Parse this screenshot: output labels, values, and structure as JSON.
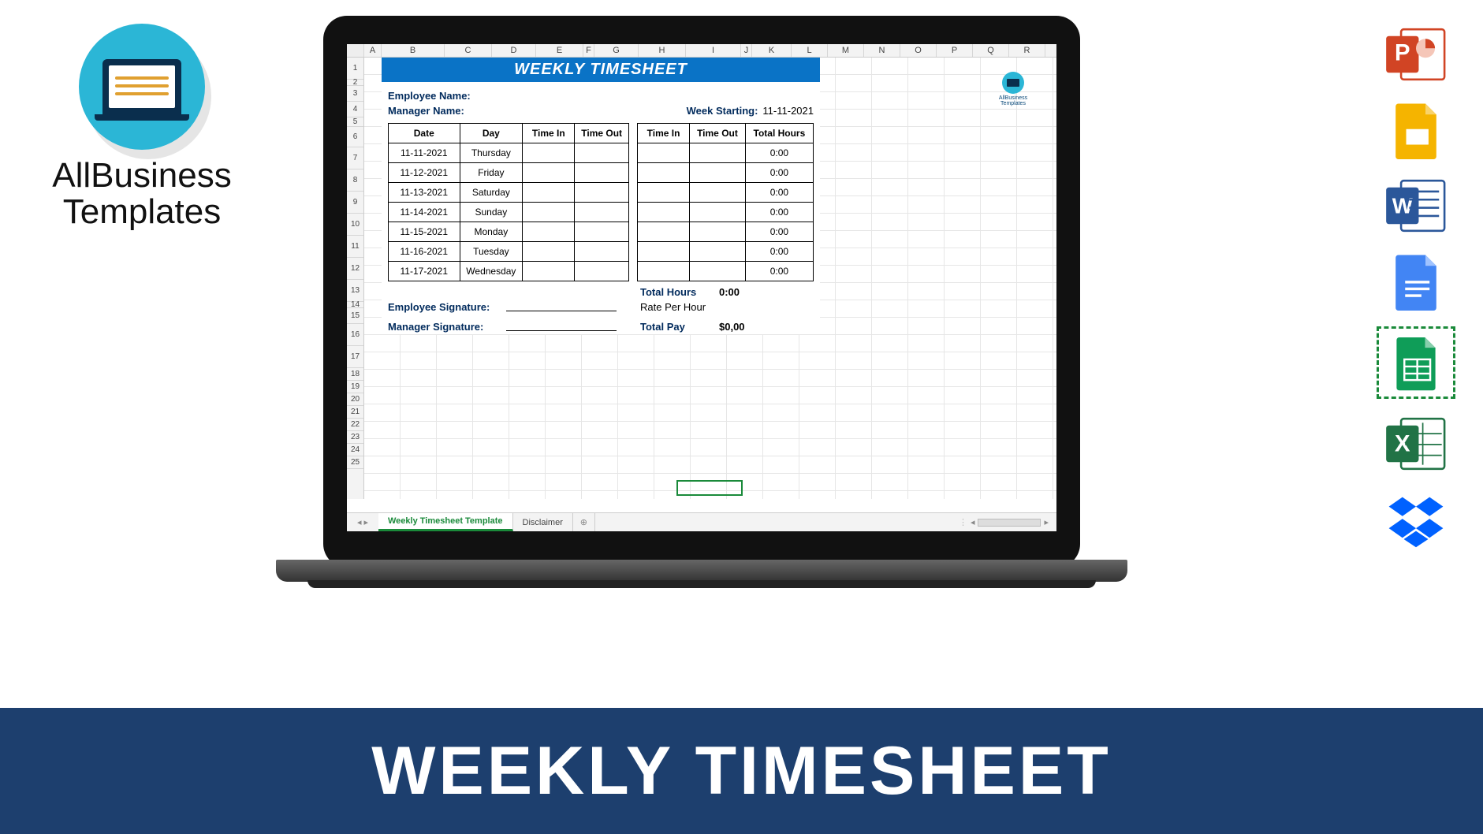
{
  "brand": {
    "line1": "AllBusiness",
    "line2": "Templates"
  },
  "banner": {
    "title": "WEEKLY TIMESHEET"
  },
  "spreadsheet": {
    "columns": [
      "A",
      "B",
      "C",
      "D",
      "E",
      "F",
      "G",
      "H",
      "I",
      "J",
      "K",
      "L",
      "M",
      "N",
      "O",
      "P",
      "Q",
      "R"
    ],
    "row_numbers": [
      "1",
      "2",
      "3",
      "4",
      "5",
      "6",
      "7",
      "8",
      "9",
      "10",
      "11",
      "12",
      "13",
      "14",
      "15",
      "16",
      "17",
      "18",
      "19",
      "20",
      "21",
      "22",
      "23",
      "24",
      "25"
    ],
    "sheet_tabs": {
      "active": "Weekly Timesheet Template",
      "other": "Disclaimer"
    },
    "watermark": "AllBusiness Templates",
    "timesheet": {
      "title": "WEEKLY TIMESHEET",
      "employee_label": "Employee Name:",
      "manager_label": "Manager Name:",
      "week_label": "Week Starting:",
      "week_value": "11-11-2021",
      "headers": {
        "date": "Date",
        "day": "Day",
        "time_in": "Time In",
        "time_out": "Time Out",
        "total": "Total Hours"
      },
      "rows": [
        {
          "date": "11-11-2021",
          "day": "Thursday",
          "t1": "",
          "t2": "",
          "t3": "",
          "t4": "",
          "total": "0:00"
        },
        {
          "date": "11-12-2021",
          "day": "Friday",
          "t1": "",
          "t2": "",
          "t3": "",
          "t4": "",
          "total": "0:00"
        },
        {
          "date": "11-13-2021",
          "day": "Saturday",
          "t1": "",
          "t2": "",
          "t3": "",
          "t4": "",
          "total": "0:00"
        },
        {
          "date": "11-14-2021",
          "day": "Sunday",
          "t1": "",
          "t2": "",
          "t3": "",
          "t4": "",
          "total": "0:00"
        },
        {
          "date": "11-15-2021",
          "day": "Monday",
          "t1": "",
          "t2": "",
          "t3": "",
          "t4": "",
          "total": "0:00"
        },
        {
          "date": "11-16-2021",
          "day": "Tuesday",
          "t1": "",
          "t2": "",
          "t3": "",
          "t4": "",
          "total": "0:00"
        },
        {
          "date": "11-17-2021",
          "day": "Wednesday",
          "t1": "",
          "t2": "",
          "t3": "",
          "t4": "",
          "total": "0:00"
        }
      ],
      "total_hours_label": "Total Hours",
      "total_hours_value": "0:00",
      "rate_label": "Rate Per Hour",
      "rate_value": "",
      "total_pay_label": "Total Pay",
      "total_pay_value": "$0,00",
      "emp_sig_label": "Employee Signature:",
      "mgr_sig_label": "Manager Signature:"
    }
  },
  "icons": {
    "powerpoint": "powerpoint-icon",
    "slides": "google-slides-icon",
    "word": "word-icon",
    "docs": "google-docs-icon",
    "sheets": "google-sheets-icon",
    "excel": "excel-icon",
    "dropbox": "dropbox-icon"
  }
}
